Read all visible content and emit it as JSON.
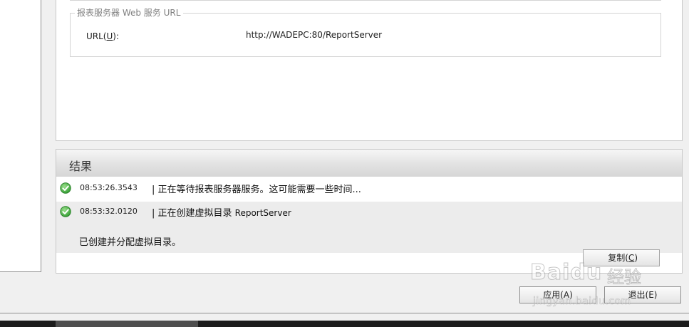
{
  "report_server_url": {
    "group_title": "报表服务器 Web 服务 URL",
    "url_label_prefix": "URL(",
    "url_label_mnemonic": "U",
    "url_label_suffix": "):",
    "url_value": "http://WADEPC:80/ReportServer"
  },
  "results": {
    "title": "结果",
    "entries": [
      {
        "time": "08:53:26.3543",
        "message": "| 正在等待报表服务器服务。这可能需要一些时间...",
        "status": "success"
      },
      {
        "time": "08:53:32.0120",
        "message_prefix": "| 正在创建虚拟目录 ",
        "message_name": "ReportServer",
        "detail": "已创建并分配虚拟目录。",
        "status": "success"
      }
    ],
    "copy_label_prefix": "复制(",
    "copy_label_mnemonic": "C",
    "copy_label_suffix": ")"
  },
  "footer": {
    "apply_label": "应用(A)",
    "exit_label": "退出(E)"
  },
  "watermark": {
    "logo": "Bai",
    "logo_icon": "du",
    "cn_text": "经验",
    "url": "jingyan.baidu.com"
  },
  "colors": {
    "success_green": "#3aa63a",
    "panel_border": "#c8c8c8",
    "header_gradient_end": "#d6d6d6"
  },
  "icons": {
    "status_success": "check-circle-icon"
  }
}
